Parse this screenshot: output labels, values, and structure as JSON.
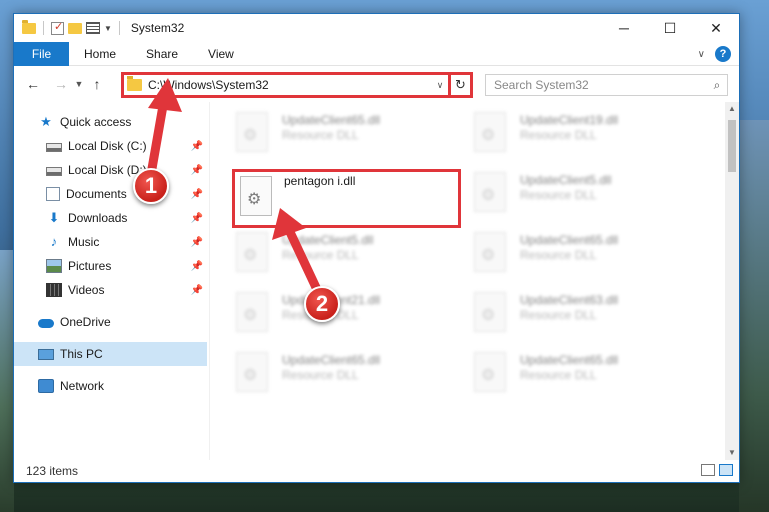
{
  "window": {
    "title": "System32",
    "controls": {
      "minimize": "─",
      "maximize": "☐",
      "close": "✕"
    }
  },
  "ribbon": {
    "tabs": [
      {
        "label": "File"
      },
      {
        "label": "Home"
      },
      {
        "label": "Share"
      },
      {
        "label": "View"
      }
    ],
    "help": "?"
  },
  "address": {
    "path": "C:\\Windows\\System32",
    "search_placeholder": "Search System32"
  },
  "sidebar": {
    "items": [
      {
        "label": "Quick access",
        "icon": "star-icon",
        "pinned": false
      },
      {
        "label": "Local Disk (C:)",
        "icon": "drive-icon",
        "pinned": true
      },
      {
        "label": "Local Disk (D:)",
        "icon": "drive-icon",
        "pinned": true
      },
      {
        "label": "Documents",
        "icon": "documents-icon",
        "pinned": true
      },
      {
        "label": "Downloads",
        "icon": "download-icon",
        "pinned": true
      },
      {
        "label": "Music",
        "icon": "music-icon",
        "pinned": true
      },
      {
        "label": "Pictures",
        "icon": "pictures-icon",
        "pinned": true
      },
      {
        "label": "Videos",
        "icon": "videos-icon",
        "pinned": true
      },
      {
        "label": "OneDrive",
        "icon": "cloud-icon",
        "pinned": false
      },
      {
        "label": "This PC",
        "icon": "computer-icon",
        "pinned": false,
        "selected": true
      },
      {
        "label": "Network",
        "icon": "network-icon",
        "pinned": false
      }
    ]
  },
  "files": [
    {
      "name": "UpdateClient65.dll",
      "type": "Resource DLL",
      "blurred": true
    },
    {
      "name": "UpdateClient19.dll",
      "type": "Resource DLL",
      "blurred": true
    },
    {
      "name": "pentagon i.dll",
      "type": "",
      "blurred": false,
      "highlighted": true
    },
    {
      "name": "UpdateClient5.dll",
      "type": "Resource DLL",
      "blurred": true
    },
    {
      "name": "UpdateClient5.dll",
      "type": "Resource DLL",
      "blurred": true
    },
    {
      "name": "UpdateClient65.dll",
      "type": "Resource DLL",
      "blurred": true
    },
    {
      "name": "UpdateClient21.dll",
      "type": "Resource DLL",
      "blurred": true
    },
    {
      "name": "UpdateClient63.dll",
      "type": "Resource DLL",
      "blurred": true
    },
    {
      "name": "UpdateClient65.dll",
      "type": "Resource DLL",
      "blurred": true
    },
    {
      "name": "UpdateClient65.dll",
      "type": "Resource DLL",
      "blurred": true
    }
  ],
  "status": {
    "item_count": "123 items"
  },
  "annotations": {
    "step1": "1",
    "step2": "2",
    "color": "#e0353a"
  }
}
